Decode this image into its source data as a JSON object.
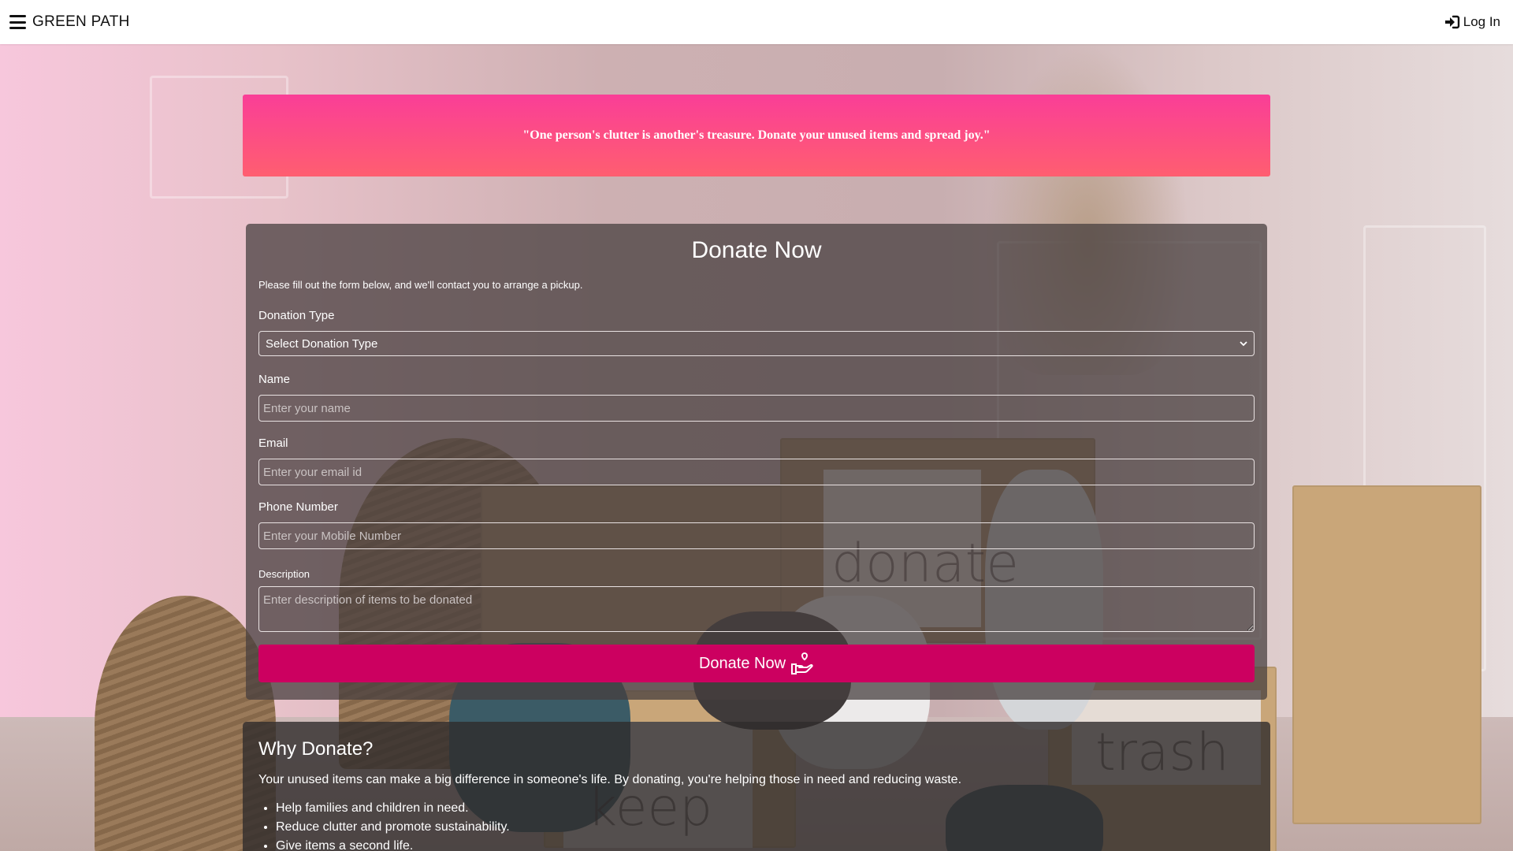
{
  "topbar": {
    "menu_icon": "hamburger-menu-icon",
    "brand": "GREEN PATH",
    "login_icon": "sign-in-icon",
    "login_label": "Log In"
  },
  "quote": {
    "text": "\"One person's clutter is another's treasure. Donate your unused items and spread joy.\""
  },
  "form": {
    "title": "Donate Now",
    "intro": "Please fill out the form below, and we'll contact you to arrange a pickup.",
    "donation_type": {
      "label": "Donation Type",
      "selected": "Select Donation Type"
    },
    "name": {
      "label": "Name",
      "placeholder": "Enter your name",
      "value": ""
    },
    "email": {
      "label": "Email",
      "placeholder": "Enter your email id",
      "value": ""
    },
    "phone": {
      "label": "Phone Number",
      "placeholder": "Enter your Mobile Number",
      "value": ""
    },
    "description": {
      "label": "Description",
      "placeholder": "Enter description of items to be donated",
      "value": ""
    },
    "submit_label": "Donate Now",
    "submit_icon": "hand-holding-heart-icon"
  },
  "why": {
    "title": "Why Donate?",
    "text": "Your unused items can make a big difference in someone's life. By donating, you're helping those in need and reducing waste.",
    "points": [
      "Help families and children in need.",
      "Reduce clutter and promote sustainability.",
      "Give items a second life."
    ]
  },
  "colors": {
    "quote_gradient_start": "#fa3e97",
    "quote_gradient_end": "#ff5e70",
    "button": "#cc0060",
    "card": "#463e3e"
  }
}
